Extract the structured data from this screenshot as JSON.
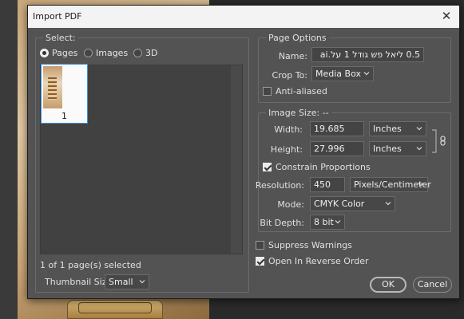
{
  "dialog": {
    "title": "Import PDF",
    "close_glyph": "✕"
  },
  "select": {
    "group_label": "Select:",
    "radios": [
      {
        "label": "Pages",
        "selected": true
      },
      {
        "label": "Images",
        "selected": false
      },
      {
        "label": "3D",
        "selected": false
      }
    ],
    "thumbnails": [
      {
        "page_number": "1",
        "selected": true
      }
    ],
    "status": "1 of 1 page(s) selected",
    "thumbnail_size_label": "Thumbnail Size:",
    "thumbnail_size_value": "Small"
  },
  "page_options": {
    "group_label": "Page Options",
    "name_label": "Name:",
    "name_value": "0.5 ליאל פש גודל 1 על.ai",
    "crop_to_label": "Crop To:",
    "crop_to_value": "Media Box",
    "anti_aliased_label": "Anti-aliased",
    "anti_aliased_checked": false
  },
  "image_size": {
    "group_label": "Image Size: --",
    "width_label": "Width:",
    "width_value": "19.685",
    "width_unit": "Inches",
    "height_label": "Height:",
    "height_value": "27.996",
    "height_unit": "Inches",
    "constrain_label": "Constrain Proportions",
    "constrain_checked": true,
    "resolution_label": "Resolution:",
    "resolution_value": "450",
    "resolution_unit": "Pixels/Centimeter",
    "mode_label": "Mode:",
    "mode_value": "CMYK Color",
    "bit_depth_label": "Bit Depth:",
    "bit_depth_value": "8 bit"
  },
  "options": {
    "suppress_warnings_label": "Suppress Warnings",
    "suppress_warnings_checked": false,
    "reverse_order_label": "Open In Reverse Order",
    "reverse_order_checked": true
  },
  "buttons": {
    "ok": "OK",
    "cancel": "Cancel"
  },
  "icons": {
    "close": "close-icon",
    "link": "chain-link-icon",
    "caret": "chevron-down-icon"
  }
}
